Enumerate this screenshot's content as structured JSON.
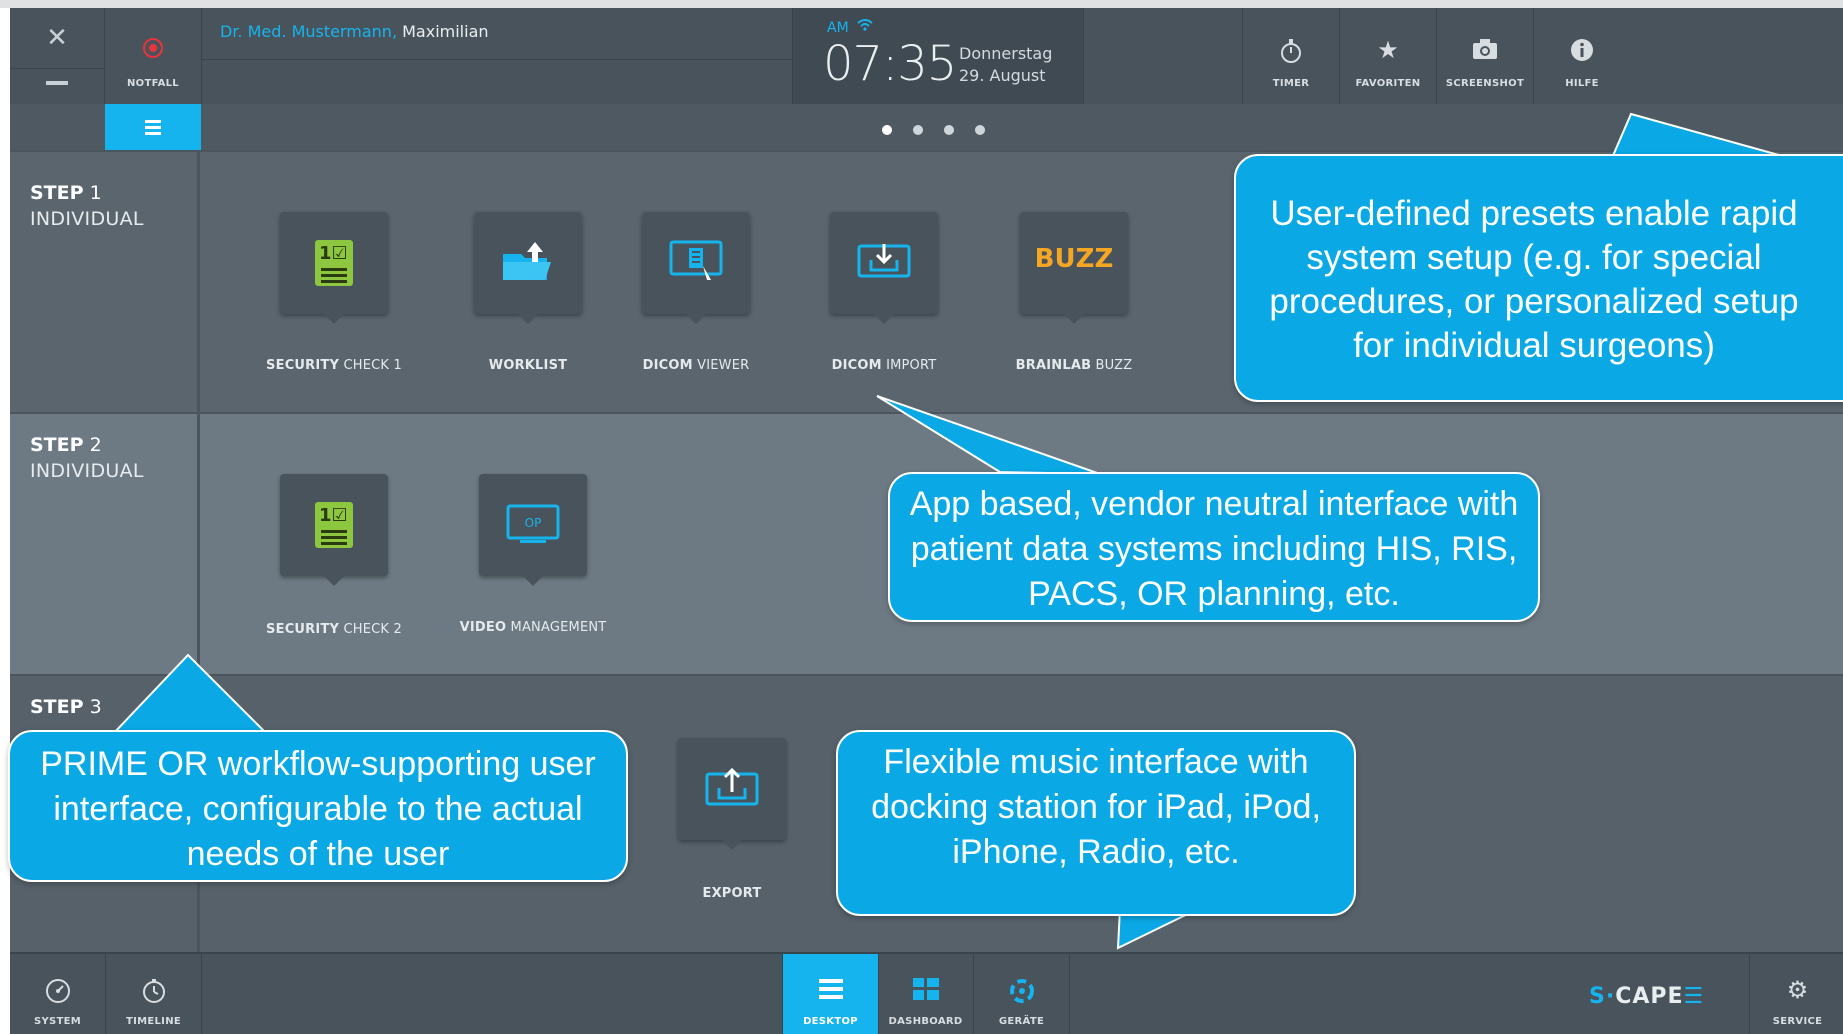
{
  "header": {
    "close_glyph": "✕",
    "notfall_label": "NOTFALL",
    "user_title": "Dr. Med. Mustermann,",
    "user_name": " Maximilian",
    "clock": {
      "ampm": "AM",
      "time": "07:35",
      "day": "Donnerstag",
      "date": "29. August"
    },
    "tools": [
      {
        "label": "TIMER",
        "icon": "stopwatch-icon"
      },
      {
        "label": "FAVORITEN",
        "icon": "star-icon"
      },
      {
        "label": "SCREENSHOT",
        "icon": "camera-icon"
      },
      {
        "label": "HILFE",
        "icon": "info-icon"
      }
    ]
  },
  "pager": {
    "pages": 4,
    "active": 1
  },
  "steps": [
    {
      "title": "STEP",
      "number": "1",
      "subtitle": "INDIVIDUAL",
      "apps": [
        {
          "label_bold": "SECURITY",
          "label_rest": " CHECK 1",
          "icon": "checklist-icon"
        },
        {
          "label_bold": "WORKLIST",
          "label_rest": "",
          "icon": "folder-upload-icon"
        },
        {
          "label_bold": "DICOM",
          "label_rest": " VIEWER",
          "icon": "dicom-viewer-icon"
        },
        {
          "label_bold": "DICOM",
          "label_rest": " IMPORT",
          "icon": "dicom-import-icon"
        },
        {
          "label_bold": "BRAINLAB",
          "label_rest": " BUZZ",
          "icon": "buzz-logo",
          "logo_text": "BUZZ"
        }
      ]
    },
    {
      "title": "STEP",
      "number": "2",
      "subtitle": "INDIVIDUAL",
      "apps": [
        {
          "label_bold": "SECURITY",
          "label_rest": " CHECK 2",
          "icon": "checklist-icon"
        },
        {
          "label_bold": "VIDEO",
          "label_rest": " MANAGEMENT",
          "icon": "video-monitor-icon",
          "icon_text": "OP"
        }
      ]
    },
    {
      "title": "STEP",
      "number": "3",
      "subtitle": "",
      "apps": [
        {
          "label_bold": "EXPORT",
          "label_rest": "",
          "icon": "export-icon"
        }
      ]
    }
  ],
  "bottom": {
    "left": [
      {
        "label": "SYSTEM",
        "icon": "gauge-icon"
      },
      {
        "label": "TIMELINE",
        "icon": "clock-icon"
      }
    ],
    "center": [
      {
        "label": "DESKTOP",
        "icon": "menu-icon",
        "active": true
      },
      {
        "label": "DASHBOARD",
        "icon": "grid-icon",
        "active": false
      },
      {
        "label": "GERÄTE",
        "icon": "devices-icon",
        "active": false
      }
    ],
    "brand": {
      "prefix": "S",
      "dot": "·",
      "name": "CAPE",
      "suffix": "☰"
    },
    "service_label": "SERVICE"
  },
  "callouts": {
    "presets": "User-defined presets enable rapid system setup (e.g. for special procedures, or personalized setup for individual surgeons)",
    "app_based": "App based, vendor neutral interface with patient data systems including HIS, RIS, PACS, OR planning, etc.",
    "prime": "PRIME OR workflow-supporting user interface, configurable to the actual needs of the user",
    "music": "Flexible music interface with docking station for iPad, iPod, iPhone, Radio, etc."
  },
  "colors": {
    "accent": "#16b4ee",
    "callout": "#0aa9e6",
    "alarm": "#e8343a",
    "check_green": "#8dc63f",
    "buzz_orange": "#f5a623"
  }
}
